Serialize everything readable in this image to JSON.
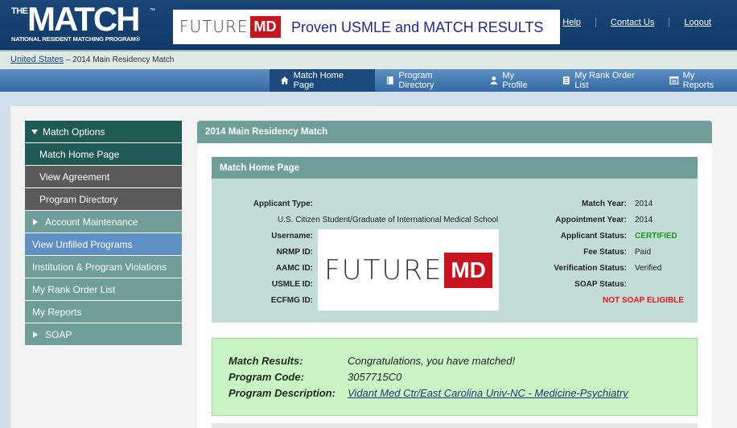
{
  "header": {
    "logo_the": "THE",
    "logo_match": "MATCH",
    "logo_sub": "NATIONAL RESIDENT MATCHING PROGRAM®",
    "banner_logo_future": "FUTURE",
    "banner_logo_md": "MD",
    "banner_text": "Proven USMLE and MATCH RESULTS",
    "links": [
      "Help",
      "Contact Us",
      "Logout"
    ]
  },
  "breadcrumb": {
    "root": "United States",
    "separator": " – ",
    "current": "2014 Main Residency Match"
  },
  "nav": {
    "items": [
      {
        "label": "Match Home Page",
        "icon": "home-icon",
        "active": true
      },
      {
        "label": "Program Directory",
        "icon": "book-icon"
      },
      {
        "label": "My Profile",
        "icon": "person-icon"
      },
      {
        "label": "My Rank Order List",
        "icon": "list-icon"
      },
      {
        "label": "My Reports",
        "icon": "reports-icon"
      }
    ]
  },
  "sidebar": {
    "items": [
      {
        "label": "Match Options"
      },
      {
        "label": "Match Home Page"
      },
      {
        "label": "View Agreement"
      },
      {
        "label": "Program Directory"
      },
      {
        "label": "Account Maintenance"
      },
      {
        "label": "View Unfilled Programs"
      },
      {
        "label": "Institution & Program Violations"
      },
      {
        "label": "My Rank Order List"
      },
      {
        "label": "My Reports"
      },
      {
        "label": "SOAP"
      }
    ]
  },
  "content": {
    "title": "2014 Main Residency Match",
    "box_title": "Match Home Page",
    "left_fields": {
      "applicant_type_label": "Applicant Type:",
      "applicant_type_value": "U.S. Citizen Student/Graduate of International Medical School",
      "username_label": "Username:",
      "nrmp_label": "NRMP ID:",
      "aamc_label": "AAMC ID:",
      "usmle_label": "USMLE ID:",
      "ecfmg_label": "ECFMG ID:"
    },
    "photo_future": "FUTURE",
    "photo_md": "MD",
    "right_fields": {
      "match_year_label": "Match Year:",
      "match_year_value": "2014",
      "appointment_year_label": "Appointment Year:",
      "appointment_year_value": "2014",
      "applicant_status_label": "Applicant Status:",
      "applicant_status_value": "CERTIFIED",
      "fee_status_label": "Fee Status:",
      "fee_status_value": "Paid",
      "verification_status_label": "Verification Status:",
      "verification_status_value": "Verified",
      "soap_status_label": "SOAP Status:",
      "soap_status_value": "NOT SOAP ELIGIBLE"
    },
    "results": {
      "match_results_label": "Match Results:",
      "match_results_value": "Congratulations, you have matched!",
      "program_code_label": "Program Code:",
      "program_code_value": "3057715C0",
      "program_description_label": "Program Description:",
      "program_description_value": "Vidant Med Ctr/East Carolina Univ-NC - Medicine-Psychiatry"
    }
  },
  "colors": {
    "header_blue": "#0f3a68",
    "teal": "#6f9d97",
    "dark_green": "#1f5a55",
    "certified_green": "#1a9a1a",
    "not_eligible_red": "#e01818",
    "results_bg": "#c9f5c4"
  }
}
